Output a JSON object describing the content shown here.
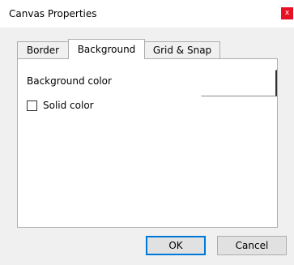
{
  "window": {
    "title": "Canvas Properties",
    "close_glyph": "x"
  },
  "tabs": [
    {
      "label": "Border",
      "active": false
    },
    {
      "label": "Background",
      "active": true
    },
    {
      "label": "Grid & Snap",
      "active": false
    }
  ],
  "background": {
    "color_label": "Background color",
    "color_value": "#ffffff",
    "solid_color_label": "Solid color",
    "solid_color_checked": false
  },
  "buttons": {
    "ok": "OK",
    "cancel": "Cancel"
  },
  "colors": {
    "close_bg": "#e81123",
    "ok_focus_border": "#0078d7",
    "window_bg": "#f0f0f0"
  }
}
